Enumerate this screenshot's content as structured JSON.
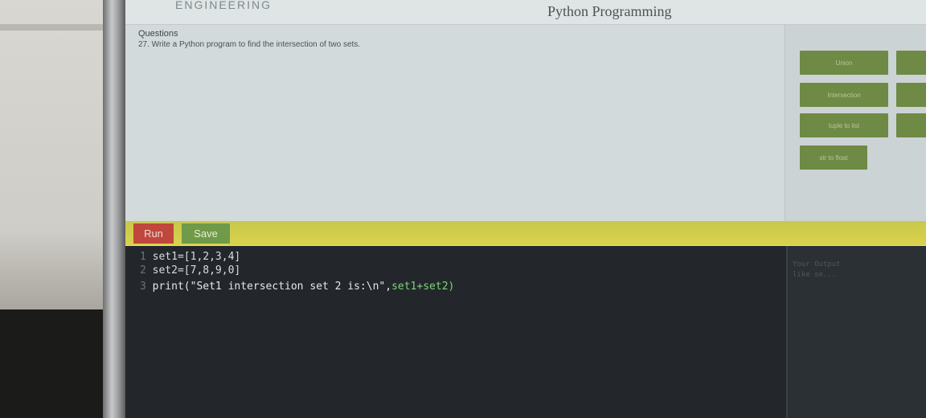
{
  "header": {
    "brand": "ENGINEERING",
    "title": "Python Programming"
  },
  "question": {
    "label": "Questions",
    "text": "27. Write a Python program to find the intersection of two sets."
  },
  "sidebar": {
    "buttons": [
      {
        "label": "Union"
      },
      {
        "label": "Intersection"
      },
      {
        "label": "tuple to list"
      },
      {
        "label": "str to float"
      }
    ]
  },
  "toolbar": {
    "run_label": "Run",
    "save_label": "Save"
  },
  "editor": {
    "lines": [
      {
        "num": "1",
        "code": "set1=[1,2,3,4]"
      },
      {
        "num": "2",
        "code": "set2=[7,8,9,0]"
      },
      {
        "num": "3",
        "pre": "print(\"Set1 intersection set 2 is:\\n\",",
        "post": "set1+set2)"
      }
    ]
  },
  "output": {
    "hint_line1": "Your Output",
    "hint_line2": "like se..."
  },
  "colors": {
    "run": "#c0473b",
    "save": "#6f9a48",
    "toolbar": "#d9d24e",
    "sidebar_button": "#6e8a44",
    "editor_bg": "#23272b"
  }
}
